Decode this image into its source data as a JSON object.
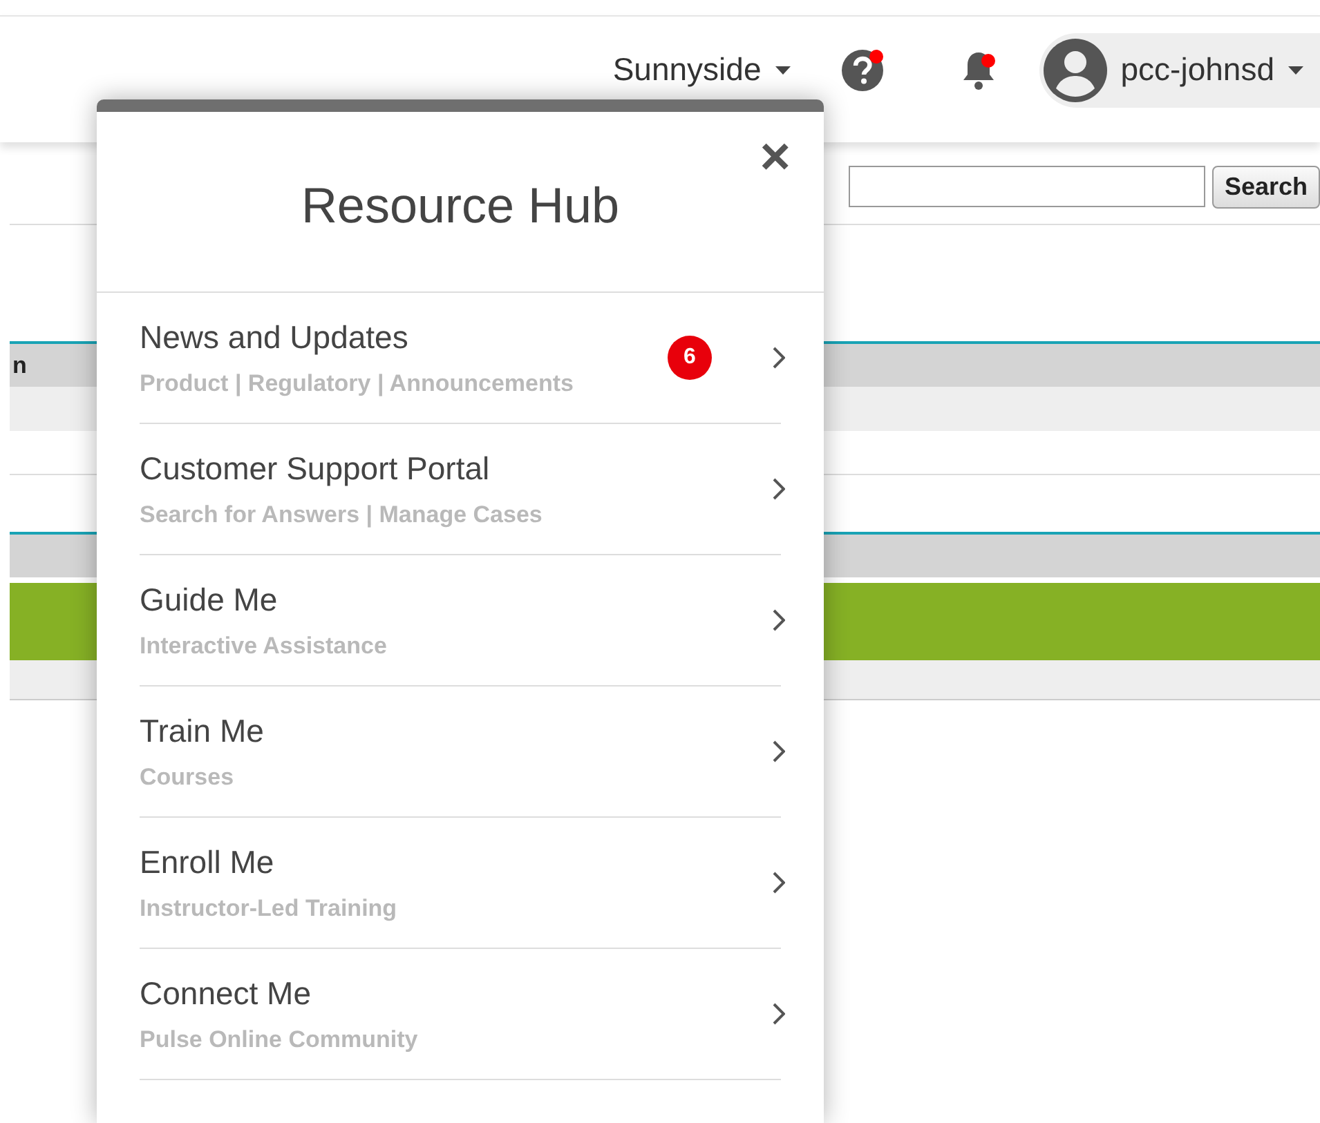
{
  "header": {
    "facility": "Sunnyside",
    "help_alert": true,
    "notifications_alert": true,
    "user": "pcc-johnsd"
  },
  "background": {
    "search_button": "Search",
    "table_header_fragment": "n"
  },
  "resource_hub": {
    "title": "Resource Hub",
    "close": "×",
    "items": [
      {
        "title": "News and Updates",
        "subtitle": "Product | Regulatory | Announcements",
        "badge": "6"
      },
      {
        "title": "Customer Support Portal",
        "subtitle": "Search for Answers | Manage Cases"
      },
      {
        "title": "Guide Me",
        "subtitle": "Interactive Assistance"
      },
      {
        "title": "Train Me",
        "subtitle": "Courses"
      },
      {
        "title": "Enroll Me",
        "subtitle": "Instructor-Led Training"
      },
      {
        "title": "Connect Me",
        "subtitle": "Pulse Online Community"
      }
    ]
  }
}
